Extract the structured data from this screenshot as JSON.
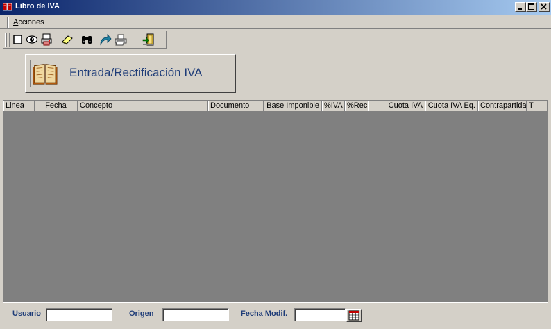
{
  "window": {
    "title": "Libro de IVA"
  },
  "menu": {
    "acciones_first": "A",
    "acciones_rest": "cciones"
  },
  "toolbar": {
    "icons": [
      "new-document-icon",
      "view-eye-icon",
      "print-preview-icon",
      "eraser-icon",
      "binoculars-icon",
      "redo-arrow-icon",
      "printer-icon",
      "exit-door-icon"
    ]
  },
  "header": {
    "title": "Entrada/Rectificación IVA"
  },
  "grid": {
    "columns": [
      {
        "label": "Linea",
        "align": "left"
      },
      {
        "label": "Fecha",
        "align": "center"
      },
      {
        "label": "Concepto",
        "align": "left"
      },
      {
        "label": "Documento",
        "align": "left"
      },
      {
        "label": "Base Imponible",
        "align": "right"
      },
      {
        "label": "%IVA",
        "align": "right"
      },
      {
        "label": "%Rec",
        "align": "right"
      },
      {
        "label": "Cuota IVA",
        "align": "right"
      },
      {
        "label": "Cuota IVA Eq.",
        "align": "right"
      },
      {
        "label": "Contrapartida",
        "align": "right"
      },
      {
        "label": "T",
        "align": "left"
      }
    ],
    "rows": []
  },
  "footer": {
    "usuario_label": "Usuario",
    "usuario_value": "",
    "origen_label": "Origen",
    "origen_value": "",
    "fecha_label": "Fecha Modif.",
    "fecha_value": ""
  },
  "colors": {
    "titlebar_start": "#0a246a",
    "titlebar_end": "#a6caf0",
    "face": "#d4d0c8",
    "grid_bg": "#808080",
    "label_blue": "#1e3c78"
  }
}
